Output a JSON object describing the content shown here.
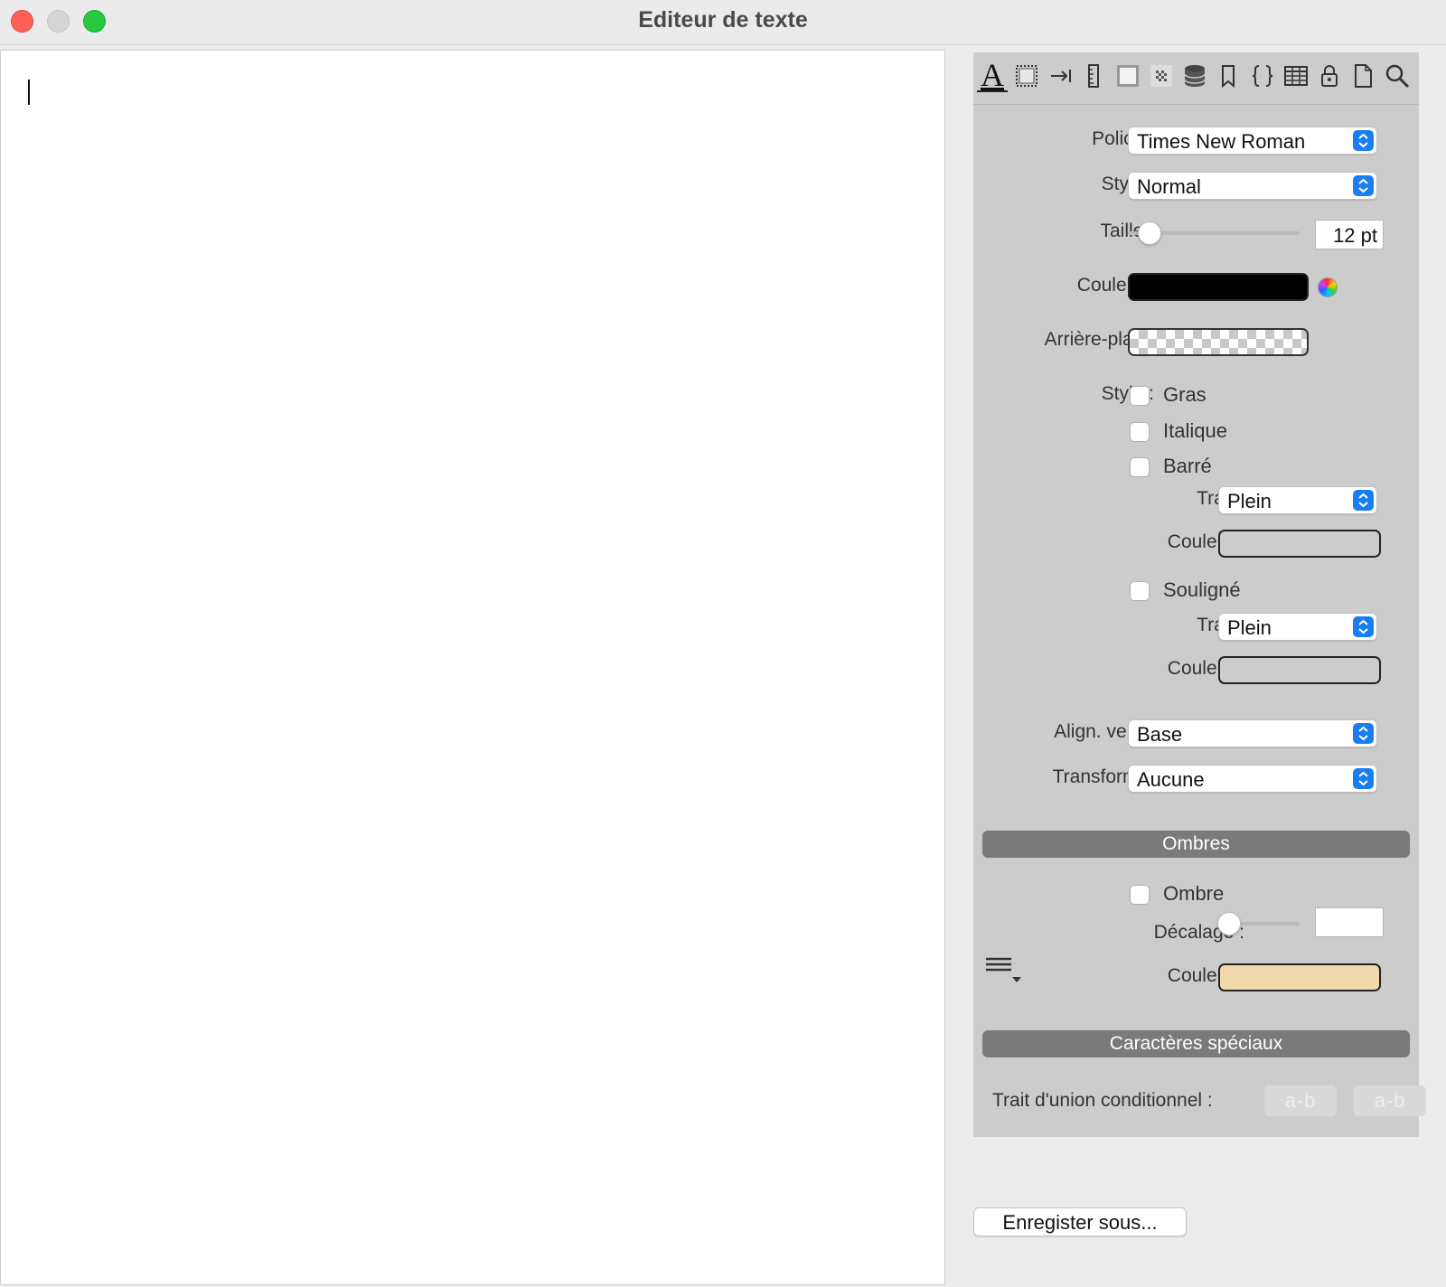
{
  "window": {
    "title": "Editeur de texte"
  },
  "toolbar": {
    "tabs": [
      {
        "icon": "font-icon",
        "glyph": "A"
      },
      {
        "icon": "frame-icon"
      },
      {
        "icon": "tab-indent-icon"
      },
      {
        "icon": "ruler-icon"
      },
      {
        "icon": "border-icon"
      },
      {
        "icon": "pattern-icon"
      },
      {
        "icon": "database-icon"
      },
      {
        "icon": "bookmark-icon"
      },
      {
        "icon": "braces-icon"
      },
      {
        "icon": "table-icon"
      },
      {
        "icon": "lock-icon"
      },
      {
        "icon": "document-icon"
      },
      {
        "icon": "search-icon"
      }
    ]
  },
  "font": {
    "police_label": "Police :",
    "police_value": "Times New Roman",
    "style_label": "Style :",
    "style_value": "Normal",
    "taille_label": "Taille :",
    "taille_value": "12 pt",
    "couleur_label": "Couleur :",
    "couleur_color": "#000000",
    "arriere_label": "Arrière-plan :"
  },
  "styles": {
    "label": "Style :",
    "gras": "Gras",
    "italique": "Italique",
    "barre": "Barré",
    "barre_trait_label": "Trait :",
    "barre_trait_value": "Plein",
    "barre_couleur_label": "Couleur :",
    "souligne": "Souligné",
    "souligne_trait_label": "Trait :",
    "souligne_trait_value": "Plein",
    "souligne_couleur_label": "Couleur :"
  },
  "align": {
    "align_label": "Align. vert. :",
    "align_value": "Base",
    "transform_label": "Transform. :",
    "transform_value": "Aucune"
  },
  "shadows": {
    "section": "Ombres",
    "ombre": "Ombre",
    "decalage_label": "Décalage :",
    "decalage_value": "",
    "couleur_label": "Couleur :",
    "couleur_color": "#f4d9ad"
  },
  "special": {
    "section": "Caractères spéciaux",
    "trait_label": "Trait d'union conditionnel :",
    "btn1": "a-b",
    "btn2": "a-b"
  },
  "footer": {
    "save_label": "Enregister sous..."
  }
}
